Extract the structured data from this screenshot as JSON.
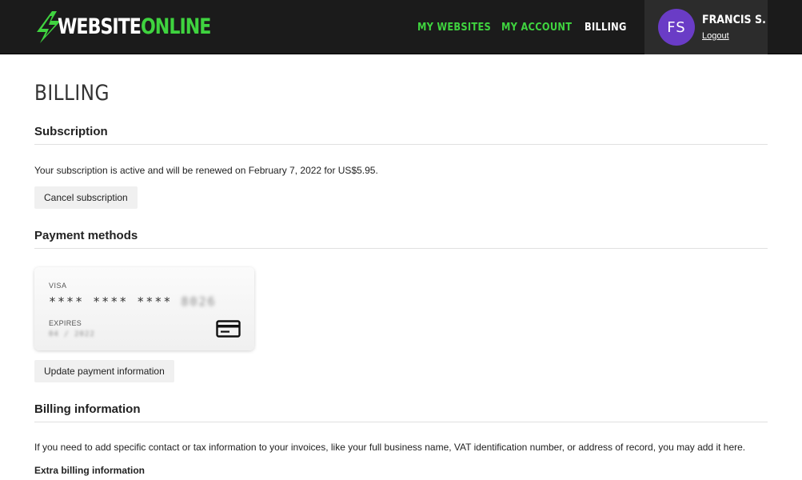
{
  "header": {
    "logo": {
      "part1": "WEBSITE",
      "part2": "ONLINE",
      "accent": "#3fd33f"
    },
    "nav": [
      {
        "label": "MY WEBSITES"
      },
      {
        "label": "MY ACCOUNT"
      },
      {
        "label": "BILLING",
        "active": true
      }
    ],
    "user": {
      "initials": "FS",
      "name": "FRANCIS S.",
      "logout": "Logout",
      "avatar_color": "#6a3cc6"
    }
  },
  "page": {
    "title": "BILLING"
  },
  "subscription": {
    "title": "Subscription",
    "status_text": "Your subscription is active and will be renewed on February 7, 2022 for US$5.95.",
    "cancel_label": "Cancel subscription"
  },
  "payment_methods": {
    "title": "Payment methods",
    "card": {
      "brand": "VISA",
      "masked": "**** **** ****",
      "last4": "8026",
      "expires_label": "EXPIRES",
      "expires_value": "04 / 2022",
      "icon": "credit-card-icon"
    },
    "update_label": "Update payment information"
  },
  "billing_info": {
    "title": "Billing information",
    "description": "If you need to add specific contact or tax information to your invoices, like your full business name, VAT identification number, or address of record, you may add it here.",
    "extra_label": "Extra billing information"
  }
}
